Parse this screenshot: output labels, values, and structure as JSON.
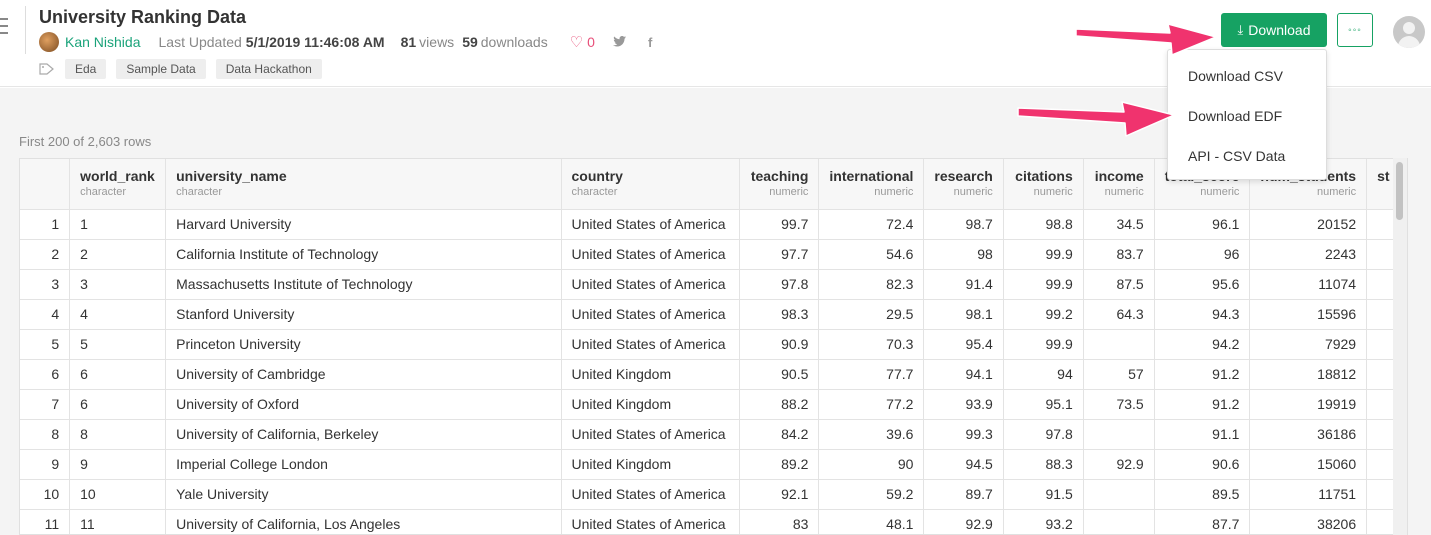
{
  "header": {
    "title": "University Ranking Data",
    "author": "Kan Nishida",
    "updated_label": "Last Updated",
    "updated_value": "5/1/2019 11:46:08 AM",
    "views_count": "81",
    "views_label": "views",
    "downloads_count": "59",
    "downloads_label": "downloads",
    "likes": "0",
    "tags": [
      "Eda",
      "Sample Data",
      "Data Hackathon"
    ],
    "download_label": "Download",
    "more_label": "◦◦◦"
  },
  "dropdown": {
    "items": [
      "Download CSV",
      "Download EDF",
      "API - CSV Data"
    ]
  },
  "table": {
    "summary": "First 200 of 2,603 rows",
    "columns": [
      {
        "name": "world_rank",
        "type": "character"
      },
      {
        "name": "university_name",
        "type": "character"
      },
      {
        "name": "country",
        "type": "character"
      },
      {
        "name": "teaching",
        "type": "numeric"
      },
      {
        "name": "international",
        "type": "numeric"
      },
      {
        "name": "research",
        "type": "numeric"
      },
      {
        "name": "citations",
        "type": "numeric"
      },
      {
        "name": "income",
        "type": "numeric"
      },
      {
        "name": "total_score",
        "type": "numeric"
      },
      {
        "name": "num_students",
        "type": "numeric"
      },
      {
        "name": "st",
        "type": ""
      }
    ],
    "rows": [
      [
        "1",
        "1",
        "Harvard University",
        "United States of America",
        "99.7",
        "72.4",
        "98.7",
        "98.8",
        "34.5",
        "96.1",
        "20152"
      ],
      [
        "2",
        "2",
        "California Institute of Technology",
        "United States of America",
        "97.7",
        "54.6",
        "98",
        "99.9",
        "83.7",
        "96",
        "2243"
      ],
      [
        "3",
        "3",
        "Massachusetts Institute of Technology",
        "United States of America",
        "97.8",
        "82.3",
        "91.4",
        "99.9",
        "87.5",
        "95.6",
        "11074"
      ],
      [
        "4",
        "4",
        "Stanford University",
        "United States of America",
        "98.3",
        "29.5",
        "98.1",
        "99.2",
        "64.3",
        "94.3",
        "15596"
      ],
      [
        "5",
        "5",
        "Princeton University",
        "United States of America",
        "90.9",
        "70.3",
        "95.4",
        "99.9",
        "",
        "94.2",
        "7929"
      ],
      [
        "6",
        "6",
        "University of Cambridge",
        "United Kingdom",
        "90.5",
        "77.7",
        "94.1",
        "94",
        "57",
        "91.2",
        "18812"
      ],
      [
        "7",
        "6",
        "University of Oxford",
        "United Kingdom",
        "88.2",
        "77.2",
        "93.9",
        "95.1",
        "73.5",
        "91.2",
        "19919"
      ],
      [
        "8",
        "8",
        "University of California, Berkeley",
        "United States of America",
        "84.2",
        "39.6",
        "99.3",
        "97.8",
        "",
        "91.1",
        "36186"
      ],
      [
        "9",
        "9",
        "Imperial College London",
        "United Kingdom",
        "89.2",
        "90",
        "94.5",
        "88.3",
        "92.9",
        "90.6",
        "15060"
      ],
      [
        "10",
        "10",
        "Yale University",
        "United States of America",
        "92.1",
        "59.2",
        "89.7",
        "91.5",
        "",
        "89.5",
        "11751"
      ],
      [
        "11",
        "11",
        "University of California, Los Angeles",
        "United States of America",
        "83",
        "48.1",
        "92.9",
        "93.2",
        "",
        "87.7",
        "38206"
      ]
    ]
  },
  "colors": {
    "accent": "#16a263",
    "author": "#1aa37a",
    "like": "#e8507a",
    "arrow": "#f0336e"
  }
}
